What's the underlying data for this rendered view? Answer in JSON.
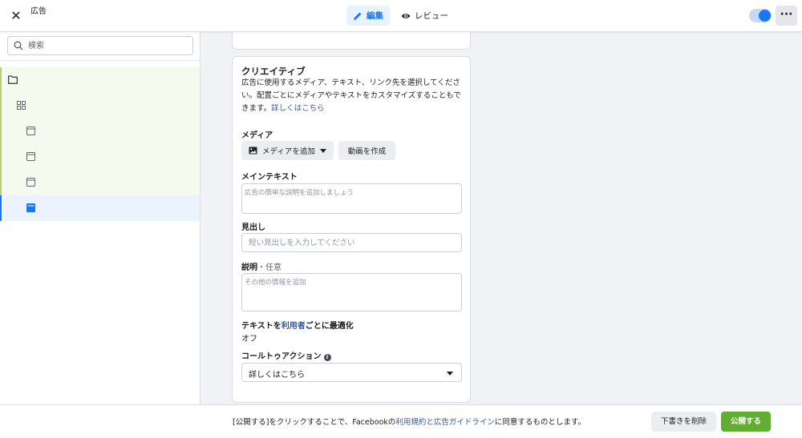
{
  "header": {
    "close_icon": "close-icon",
    "title": "広告",
    "tabs": [
      {
        "label": "編集",
        "icon": "pencil-icon",
        "active": true
      },
      {
        "label": "レビュー",
        "icon": "eye-icon",
        "active": false
      }
    ],
    "toggle_on": true,
    "more_label": "···"
  },
  "sidebar": {
    "search_placeholder": "検索",
    "tree": [
      {
        "icon": "folder-icon",
        "level": 0,
        "state": "green"
      },
      {
        "icon": "grid-icon",
        "level": 1,
        "state": "green"
      },
      {
        "icon": "ad-icon",
        "level": 2,
        "state": "green"
      },
      {
        "icon": "ad-icon",
        "level": 2,
        "state": "green"
      },
      {
        "icon": "ad-icon",
        "level": 2,
        "state": "green"
      },
      {
        "icon": "ad-icon",
        "level": 2,
        "state": "selected"
      }
    ]
  },
  "creative": {
    "title": "クリエイティブ",
    "description": "広告に使用するメディア、テキスト、リンク先を選択してください。配置ごとにメディアやテキストをカスタマイズすることもできます。",
    "learn_more": "詳しくはこちら",
    "media_label": "メディア",
    "add_media_button": "メディアを追加",
    "create_video_button": "動画を作成",
    "primary_text_label": "メインテキスト",
    "primary_text_placeholder": "広告の簡単な説明を追加しましょう",
    "headline_label": "見出し",
    "headline_placeholder": "短い見出しを入力してください",
    "description_label": "説明",
    "description_optional": "・任意",
    "description_placeholder": "その他の情報を追加",
    "optimize_label_prefix": "テキストを",
    "optimize_label_link": "利用者",
    "optimize_label_suffix": "ごとに最適化",
    "optimize_value": "オフ",
    "cta_label": "コールトゥアクション",
    "cta_value": "詳しくはこちら"
  },
  "footer": {
    "note_prefix": "[公開する]をクリックすることで、Facebookの",
    "note_link": "利用規約と広告ガイドライン",
    "note_suffix": "に同意するものとします。",
    "delete_draft_button": "下書きを削除",
    "publish_button": "公開する"
  },
  "colors": {
    "accent": "#1877f2",
    "publish": "#63ad32",
    "tree_green_bg": "#f6faee",
    "tree_green_border": "#b5d279",
    "tree_selected_bg": "#ebf3ff"
  }
}
